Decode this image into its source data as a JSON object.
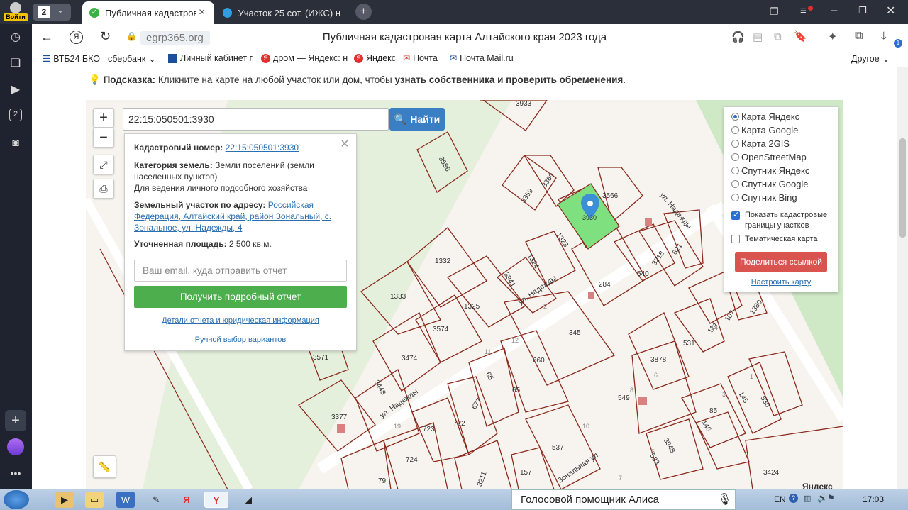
{
  "browser": {
    "profile_label": "Войти",
    "tab_counter": "2",
    "tabs": [
      {
        "title": "Публичная кадастрова"
      },
      {
        "title": "Участок 25 сот. (ИЖС) на п"
      }
    ],
    "address_domain": "egrp365.org",
    "page_title": "Публичная кадастровая карта Алтайского края 2023 года",
    "rail_counter": "2",
    "downloads_badge": "1",
    "bookmarks": [
      {
        "label": "ВТБ24 БКО",
        "icon": "list-icon"
      },
      {
        "label": "сбербанк",
        "icon": "chevron-down-icon"
      },
      {
        "label": "Личный кабинет г",
        "icon": "bank-icon"
      },
      {
        "label": "дром — Яндекс: н",
        "icon": "yandex-icon"
      },
      {
        "label": "Яндекс",
        "icon": "yandex-icon"
      },
      {
        "label": "Почта",
        "icon": "mail-icon"
      },
      {
        "label": "Почта Mail.ru",
        "icon": "mailru-icon"
      }
    ],
    "other_label": "Другое"
  },
  "hint": {
    "prefix": "Подсказка:",
    "text": " Кликните на карте на любой участок или дом, чтобы ",
    "bold": "узнать собственника и проверить обременения",
    "suffix": "."
  },
  "map": {
    "search_value": "22:15:050501:3930",
    "find_label": "Найти",
    "zoom_in": "+",
    "zoom_out": "−",
    "info": {
      "close": "×",
      "cadastral_label": "Кадастровый номер:",
      "cadastral_value": "22:15:050501:3930",
      "category_label": "Категория земель:",
      "category_value": " Земли поселений (земли населенных пунктов)",
      "usage": "Для ведения личного подсобного хозяйства",
      "address_label": "Земельный участок по адресу:",
      "address_value": "Российская Федерация, Алтайский край, район Зональный, с. Зональное, ул. Надежды, 4",
      "area_label": "Уточненная площадь:",
      "area_value": " 2 500 кв.м.",
      "email_placeholder": "Ваш email, куда отправить отчет",
      "report_button": "Получить подробный отчет",
      "details_link": "Детали отчета и юридическая информация",
      "manual_link": "Ручной выбор вариантов"
    },
    "layers": {
      "options": [
        "Карта Яндекс",
        "Карта Google",
        "Карта 2GIS",
        "OpenStreetMap",
        "Спутник Яндекс",
        "Спутник Google",
        "Спутник Bing"
      ],
      "selected": "Карта Яндекс",
      "show_borders": "Показать кадастровые границы участков",
      "thematic": "Тематическая карта",
      "share": "Поделиться ссылкой",
      "configure": "Настроить карту"
    },
    "labels": {
      "parcels": [
        "3933",
        "3586",
        "3360",
        "3359",
        "3566",
        "3930",
        "1323",
        "1332",
        "1324",
        "3941",
        "1333",
        "1325",
        "284",
        "540",
        "3218",
        "621",
        "3574",
        "3571",
        "3474",
        "345",
        "660",
        "65",
        "65",
        "3448",
        "677",
        "722",
        "723",
        "3377",
        "724",
        "79",
        "3211",
        "157",
        "537",
        "531",
        "114",
        "107",
        "1380",
        "3878",
        "549",
        "85",
        "145",
        "530",
        "146",
        "3948",
        "533",
        "3424"
      ],
      "house_numbers": [
        "2",
        "11",
        "19",
        "12",
        "10",
        "8",
        "6",
        "5",
        "7",
        "1",
        "14",
        "3"
      ],
      "streets": [
        "ул. Надежды",
        "ул. Надежды",
        "ул. Надежды",
        "Зональная ул."
      ],
      "attribution": "Яндекс"
    }
  },
  "taskbar": {
    "alice_label": "Голосовой помощник Алиса",
    "lang": "EN",
    "time": "17:03"
  }
}
